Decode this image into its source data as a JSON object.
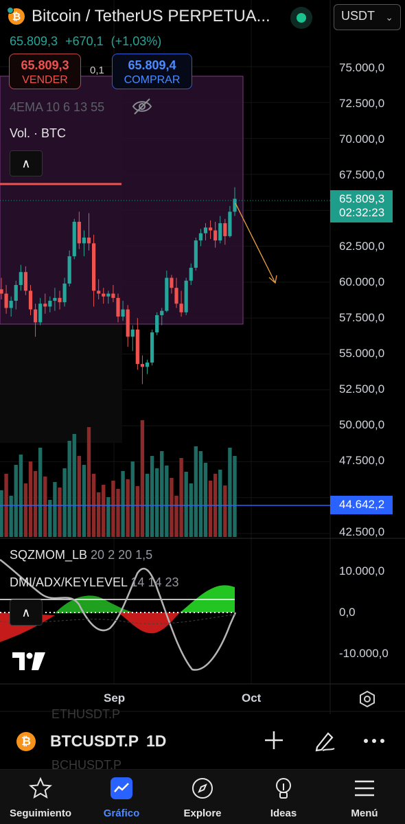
{
  "header": {
    "title": "Bitcoin / TetherUS PERPETUA...",
    "currency": "USDT",
    "last_price": "65.809,3",
    "change": "+670,1",
    "change_pct": "(+1,03%)"
  },
  "trade": {
    "sell_price": "65.809,3",
    "sell_label": "VENDER",
    "spread": "0,1",
    "buy_price": "65.809,4",
    "buy_label": "COMPRAR"
  },
  "indicators": {
    "ema": "4EMA 10 6 13 55",
    "vol": "Vol. · BTC",
    "sqz_name": "SQZMOM_LB",
    "sqz_params": "20 2 20 1,5",
    "dmi_name": "DMI/ADX/KEYLEVEL",
    "dmi_params": "14 14 23"
  },
  "price_axis": {
    "labels": [
      "75.000,0",
      "72.500,0",
      "70.000,0",
      "67.500,0",
      "62.500,0",
      "60.000,0",
      "57.500,0",
      "55.000,0",
      "52.500,0",
      "50.000,0",
      "47.500,0",
      "42.500,0"
    ],
    "current_price": "65.809,3",
    "countdown": "02:32:23",
    "hline_price": "44.642,2"
  },
  "osc_axis": {
    "labels": [
      "10.000,0",
      "0,0",
      "-10.000,0"
    ]
  },
  "time_axis": {
    "labels": [
      "Sep",
      "Oct"
    ]
  },
  "symbol_bar": {
    "symbol": "BTCUSDT.P",
    "timeframe": "1D",
    "ghost_above": "ETHUSDT.P",
    "ghost_below": "BCHUSDT.P"
  },
  "nav": {
    "items": [
      {
        "label": "Seguimiento",
        "icon": "star-icon"
      },
      {
        "label": "Gráfico",
        "icon": "chart-icon"
      },
      {
        "label": "Explore",
        "icon": "compass-icon"
      },
      {
        "label": "Ideas",
        "icon": "lightbulb-icon"
      },
      {
        "label": "Menú",
        "icon": "menu-icon"
      }
    ],
    "active_index": 1
  },
  "colors": {
    "up": "#26a69a",
    "down": "#ef5350",
    "accent": "#2962ff",
    "zone": "#2a0f2e"
  },
  "chart_data": {
    "type": "candlestick",
    "y_range": [
      42500,
      77000
    ],
    "candles": [
      [
        59500,
        60300,
        58800,
        59200
      ],
      [
        59200,
        59800,
        57800,
        58200
      ],
      [
        58200,
        59000,
        57600,
        58700
      ],
      [
        58700,
        60100,
        58100,
        59800
      ],
      [
        59800,
        61200,
        59400,
        60700
      ],
      [
        60700,
        61100,
        59100,
        59400
      ],
      [
        59400,
        59800,
        57700,
        58100
      ],
      [
        58100,
        58500,
        56200,
        57200
      ],
      [
        57200,
        58900,
        57000,
        58500
      ],
      [
        58500,
        59200,
        57800,
        58300
      ],
      [
        58300,
        59000,
        57900,
        58700
      ],
      [
        58700,
        59600,
        58000,
        58900
      ],
      [
        58900,
        59400,
        58100,
        58600
      ],
      [
        58600,
        60300,
        58300,
        59900
      ],
      [
        59900,
        62200,
        59700,
        61800
      ],
      [
        61800,
        64400,
        61600,
        64200
      ],
      [
        64200,
        64900,
        62300,
        62700
      ],
      [
        62700,
        63600,
        61800,
        63100
      ],
      [
        63100,
        64800,
        62200,
        62700
      ],
      [
        62700,
        63300,
        58300,
        59400
      ],
      [
        59400,
        60200,
        58800,
        59200
      ],
      [
        59200,
        59600,
        58500,
        59000
      ],
      [
        59000,
        59400,
        58500,
        59200
      ],
      [
        59200,
        59800,
        58600,
        58900
      ],
      [
        58900,
        59200,
        57200,
        57600
      ],
      [
        57600,
        58700,
        57300,
        58100
      ],
      [
        58100,
        58400,
        55500,
        56200
      ],
      [
        56200,
        57000,
        55200,
        56700
      ],
      [
        56700,
        57500,
        53900,
        54300
      ],
      [
        54300,
        54900,
        52900,
        54100
      ],
      [
        54100,
        54600,
        53600,
        54400
      ],
      [
        54400,
        56700,
        54200,
        56500
      ],
      [
        56500,
        57900,
        56300,
        57700
      ],
      [
        57700,
        58200,
        57000,
        58000
      ],
      [
        58000,
        60800,
        57900,
        60300
      ],
      [
        60300,
        60500,
        59200,
        59600
      ],
      [
        59600,
        60300,
        58200,
        58500
      ],
      [
        58500,
        59400,
        57600,
        57900
      ],
      [
        57900,
        60300,
        57700,
        60100
      ],
      [
        60100,
        61300,
        59800,
        61000
      ],
      [
        61000,
        63100,
        60800,
        62900
      ],
      [
        62900,
        63700,
        62500,
        63400
      ],
      [
        63400,
        64100,
        62900,
        63800
      ],
      [
        63800,
        64300,
        63000,
        63600
      ],
      [
        63600,
        64200,
        62400,
        62900
      ],
      [
        62900,
        64600,
        62700,
        64100
      ],
      [
        64100,
        64400,
        62600,
        63200
      ],
      [
        63200,
        65300,
        63100,
        64900
      ],
      [
        64900,
        66600,
        64600,
        65800
      ]
    ],
    "volume_up": [
      true,
      false,
      true,
      true,
      true,
      false,
      false,
      false,
      true,
      false,
      true,
      true,
      false,
      true,
      true,
      true,
      false,
      true,
      false,
      false,
      false,
      false,
      true,
      false,
      false,
      true,
      false,
      true,
      false,
      false,
      true,
      true,
      true,
      true,
      true,
      false,
      false,
      false,
      true,
      true,
      true,
      true,
      true,
      false,
      false,
      true,
      false,
      true,
      true
    ]
  }
}
